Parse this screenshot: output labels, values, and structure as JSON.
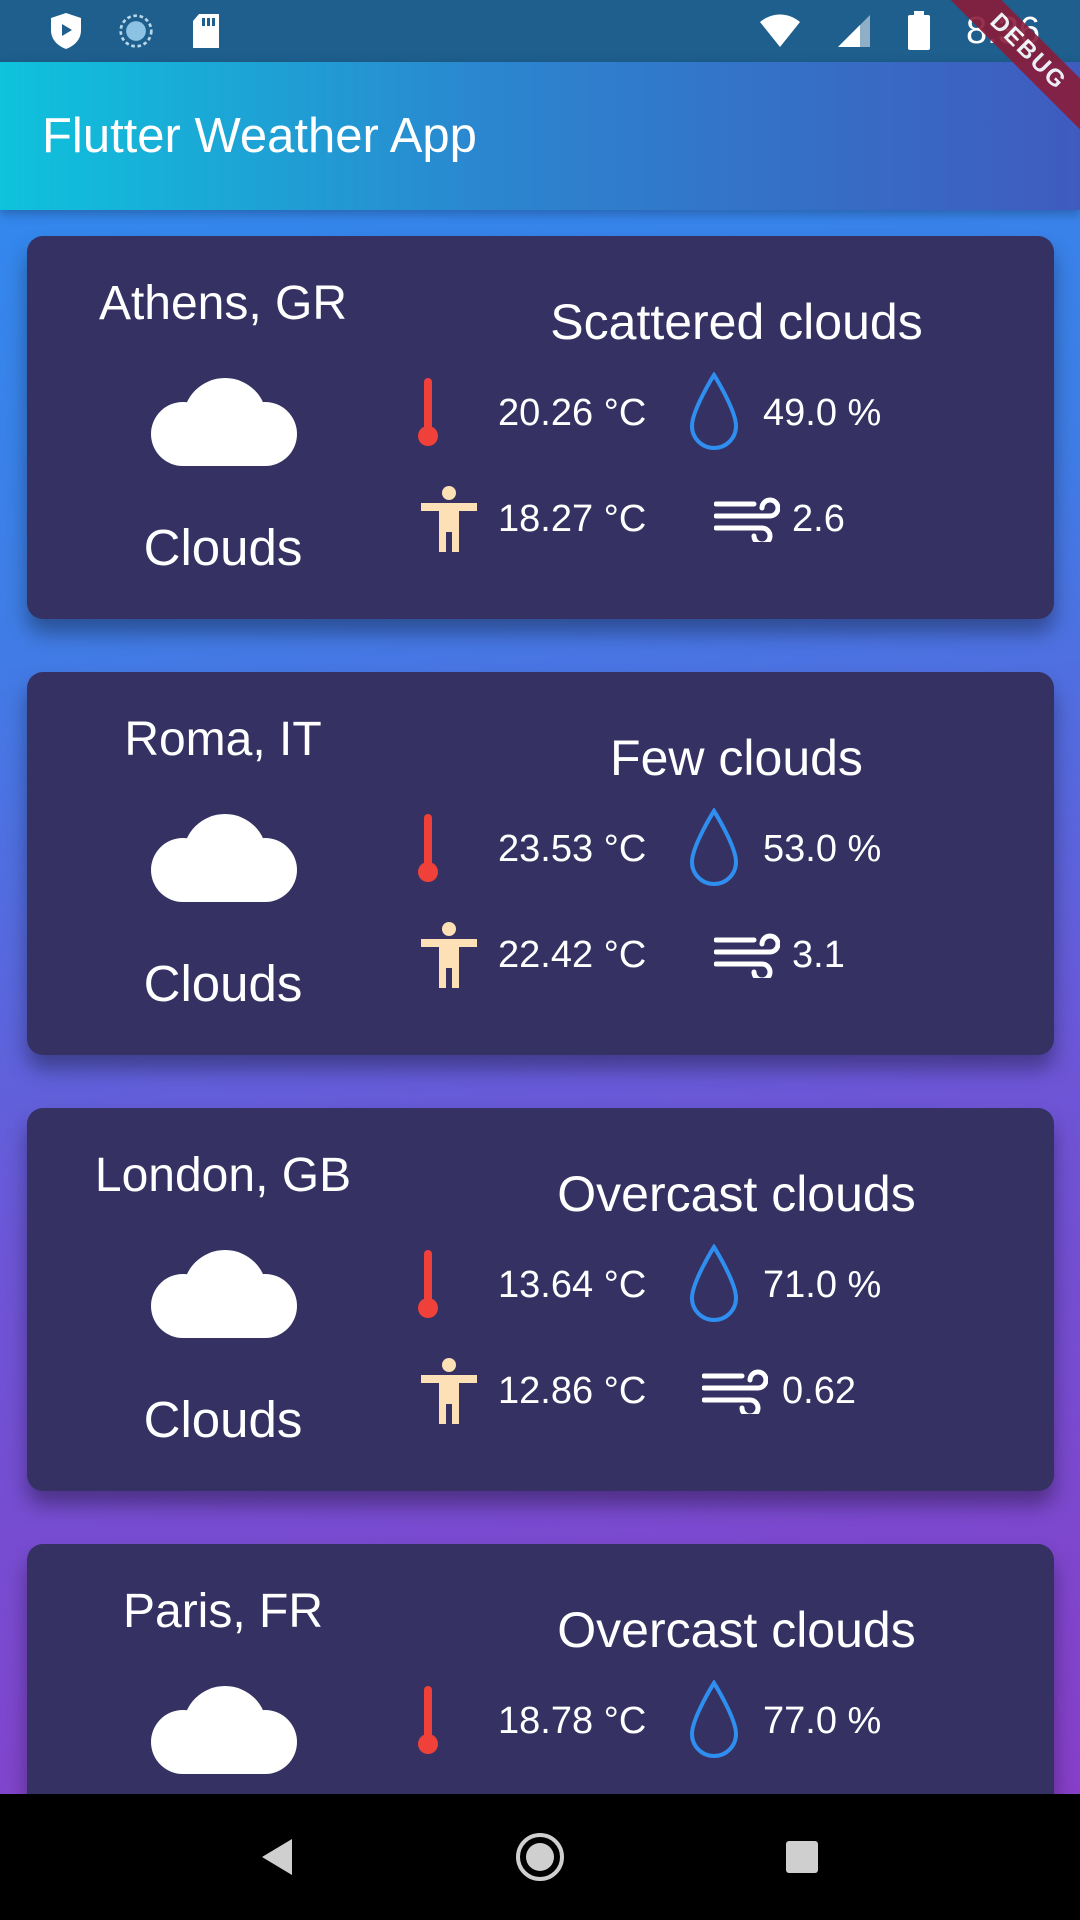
{
  "status_bar": {
    "time": "8:36"
  },
  "app_bar": {
    "title": "Flutter Weather App"
  },
  "debug_banner": "DEBUG",
  "cards": [
    {
      "city": "Athens, GR",
      "main": "Clouds",
      "description": "Scattered clouds",
      "temp": "20.26 °C",
      "humidity": "49.0 %",
      "feels_like": "18.27 °C",
      "wind": "2.6"
    },
    {
      "city": "Roma, IT",
      "main": "Clouds",
      "description": "Few clouds",
      "temp": "23.53 °C",
      "humidity": "53.0 %",
      "feels_like": "22.42 °C",
      "wind": "3.1"
    },
    {
      "city": "London, GB",
      "main": "Clouds",
      "description": "Overcast clouds",
      "temp": "13.64 °C",
      "humidity": "71.0 %",
      "feels_like": "12.86 °C",
      "wind": "0.62"
    },
    {
      "city": "Paris, FR",
      "main": "Clouds",
      "description": "Overcast clouds",
      "temp": "18.78 °C",
      "humidity": "77.0 %",
      "feels_like": "",
      "wind": ""
    }
  ],
  "colors": {
    "thermometer": "#f0403a",
    "humidity": "#2f8ff0",
    "person": "#fde0b5",
    "card": "#353263"
  }
}
